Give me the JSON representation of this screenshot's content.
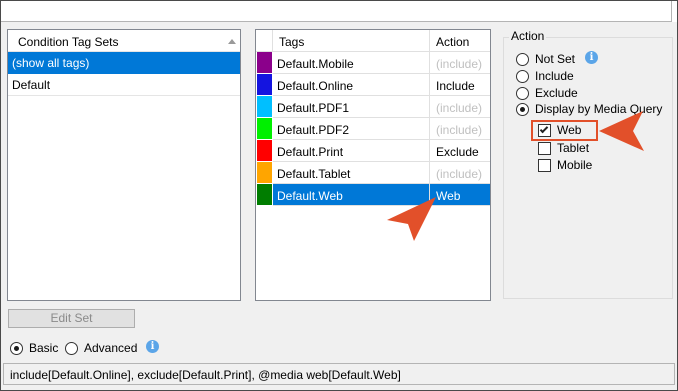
{
  "condition_tag_sets": {
    "header": "Condition Tag Sets",
    "items": [
      {
        "label": "(show all tags)",
        "selected": true
      },
      {
        "label": "Default",
        "selected": false
      }
    ]
  },
  "tags_grid": {
    "columns": [
      "Tags",
      "Action"
    ],
    "rows": [
      {
        "color": "#8b008b",
        "tag": "Default.Mobile",
        "action": "(include)",
        "action_muted": true,
        "selected": false
      },
      {
        "color": "#1414e0",
        "tag": "Default.Online",
        "action": "Include",
        "action_muted": false,
        "selected": false
      },
      {
        "color": "#00bfff",
        "tag": "Default.PDF1",
        "action": "(include)",
        "action_muted": true,
        "selected": false
      },
      {
        "color": "#00f000",
        "tag": "Default.PDF2",
        "action": "(include)",
        "action_muted": true,
        "selected": false
      },
      {
        "color": "#ff0000",
        "tag": "Default.Print",
        "action": "Exclude",
        "action_muted": false,
        "selected": false
      },
      {
        "color": "#ffa500",
        "tag": "Default.Tablet",
        "action": "(include)",
        "action_muted": true,
        "selected": false
      },
      {
        "color": "#007d00",
        "tag": "Default.Web",
        "action": "Web",
        "action_muted": false,
        "selected": true
      }
    ]
  },
  "action_panel": {
    "legend": "Action",
    "radios": [
      {
        "label": "Not Set",
        "checked": false
      },
      {
        "label": "Include",
        "checked": false
      },
      {
        "label": "Exclude",
        "checked": false
      },
      {
        "label": "Display by Media Query",
        "checked": true
      }
    ],
    "media_queries": [
      {
        "label": "Web",
        "checked": true
      },
      {
        "label": "Tablet",
        "checked": false
      },
      {
        "label": "Mobile",
        "checked": false
      }
    ],
    "info_icon_glyph": "i"
  },
  "edit_set_label": "Edit Set",
  "mode": {
    "options": [
      {
        "label": "Basic",
        "checked": true
      },
      {
        "label": "Advanced",
        "checked": false
      }
    ],
    "info_icon_glyph": "i"
  },
  "expression": "include[Default.Online], exclude[Default.Print], @media web[Default.Web]",
  "colors": {
    "selection": "#0078d7",
    "callout": "#e2502a",
    "info": "#5ba5e8"
  }
}
